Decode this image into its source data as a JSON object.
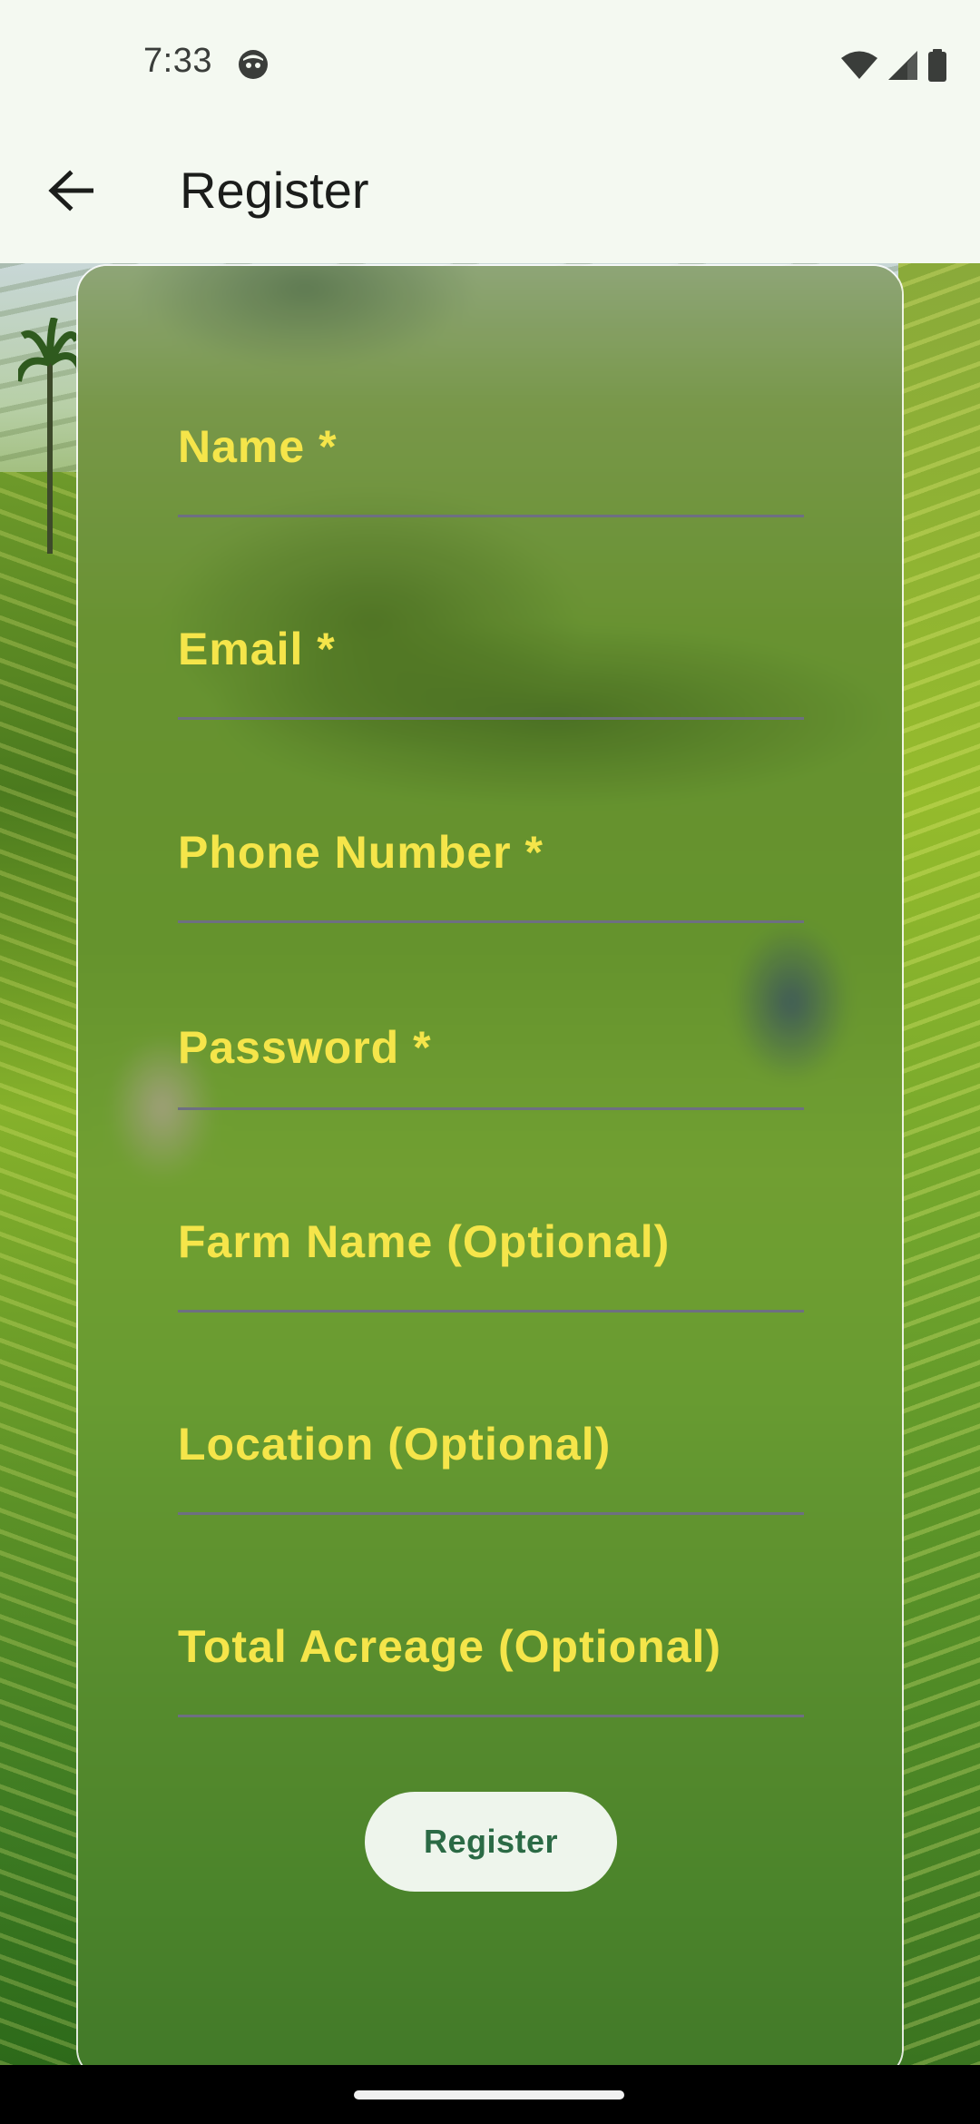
{
  "status_bar": {
    "time": "7:33",
    "icons": [
      "face-icon",
      "wifi-icon",
      "signal-icon",
      "battery-icon"
    ]
  },
  "app_bar": {
    "title": "Register",
    "back_icon": "arrow-back-icon"
  },
  "form": {
    "fields": [
      {
        "label": "Name *"
      },
      {
        "label": "Email *"
      },
      {
        "label": "Phone Number *"
      },
      {
        "label": "Password *"
      },
      {
        "label": "Farm Name (Optional)"
      },
      {
        "label": "Location (Optional)"
      },
      {
        "label": "Total Acreage (Optional)"
      }
    ],
    "submit_label": "Register"
  },
  "colors": {
    "label": "#f5e54a",
    "button_text": "#2b6a45",
    "button_bg": "#eef5ec",
    "header_bg": "#f4f9f1"
  }
}
